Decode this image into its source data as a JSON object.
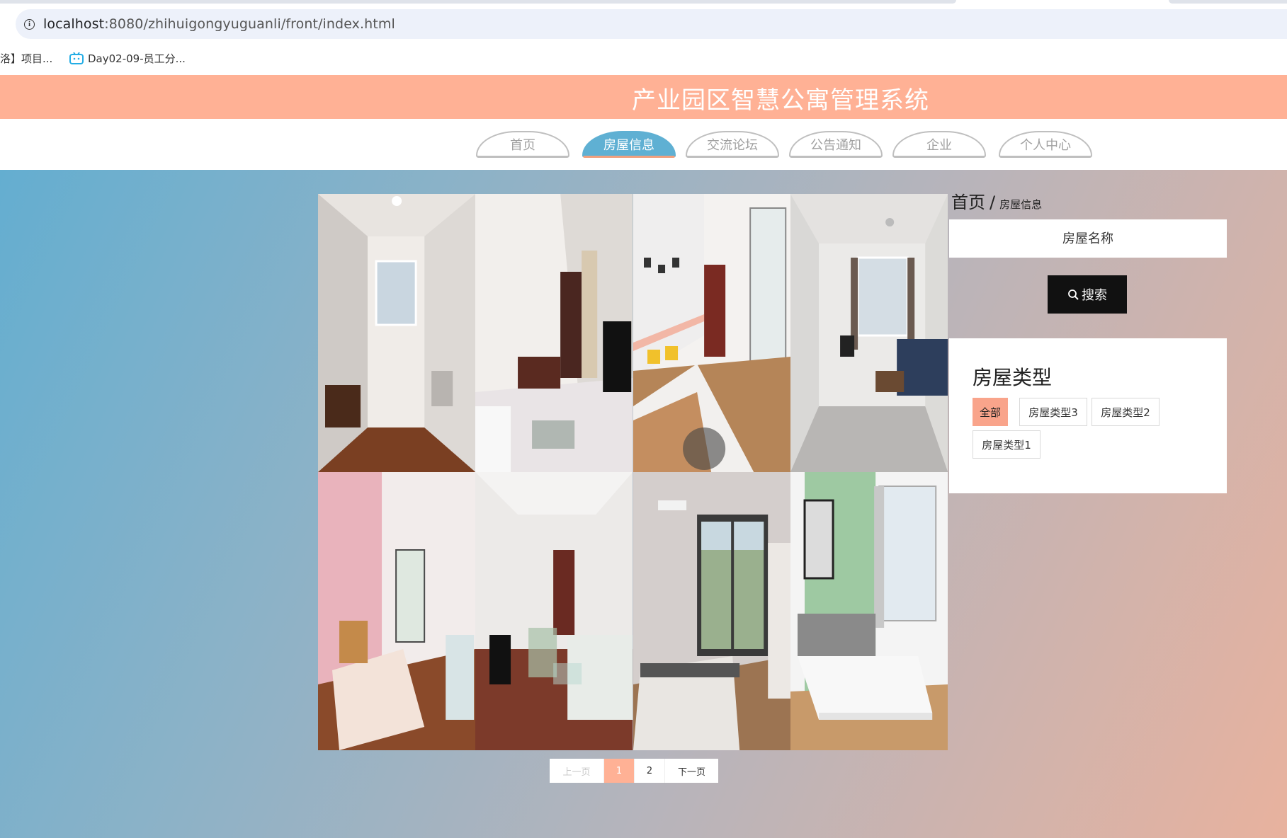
{
  "browser": {
    "url_host": "localhost",
    "url_path": ":8080/zhihuigongyuguanli/front/index.html",
    "bookmarks": [
      {
        "label": "洛】项目..."
      },
      {
        "label": "Day02-09-员工分..."
      }
    ]
  },
  "site": {
    "title": "产业园区智慧公寓管理系统"
  },
  "nav": {
    "items": [
      {
        "label": "首页"
      },
      {
        "label": "房屋信息"
      },
      {
        "label": "交流论坛"
      },
      {
        "label": "公告通知"
      },
      {
        "label": "企业"
      },
      {
        "label": "个人中心"
      }
    ],
    "active_index": 1
  },
  "breadcrumb": {
    "home": "首页",
    "separator": "/",
    "current": "房屋信息"
  },
  "search": {
    "placeholder": "房屋名称",
    "button_label": "搜索"
  },
  "house_types": {
    "title": "房屋类型",
    "options": [
      "全部",
      "房屋类型3",
      "房屋类型2",
      "房屋类型1"
    ],
    "selected": "全部"
  },
  "pagination": {
    "prev_label": "上一页",
    "pages": [
      "1",
      "2"
    ],
    "current": "1",
    "next_label": "下一页"
  },
  "colors": {
    "header_bg": "#ffb195",
    "nav_active": "#5fb0d3",
    "search_button": "#111111",
    "chip_active": "#f9a48b"
  }
}
